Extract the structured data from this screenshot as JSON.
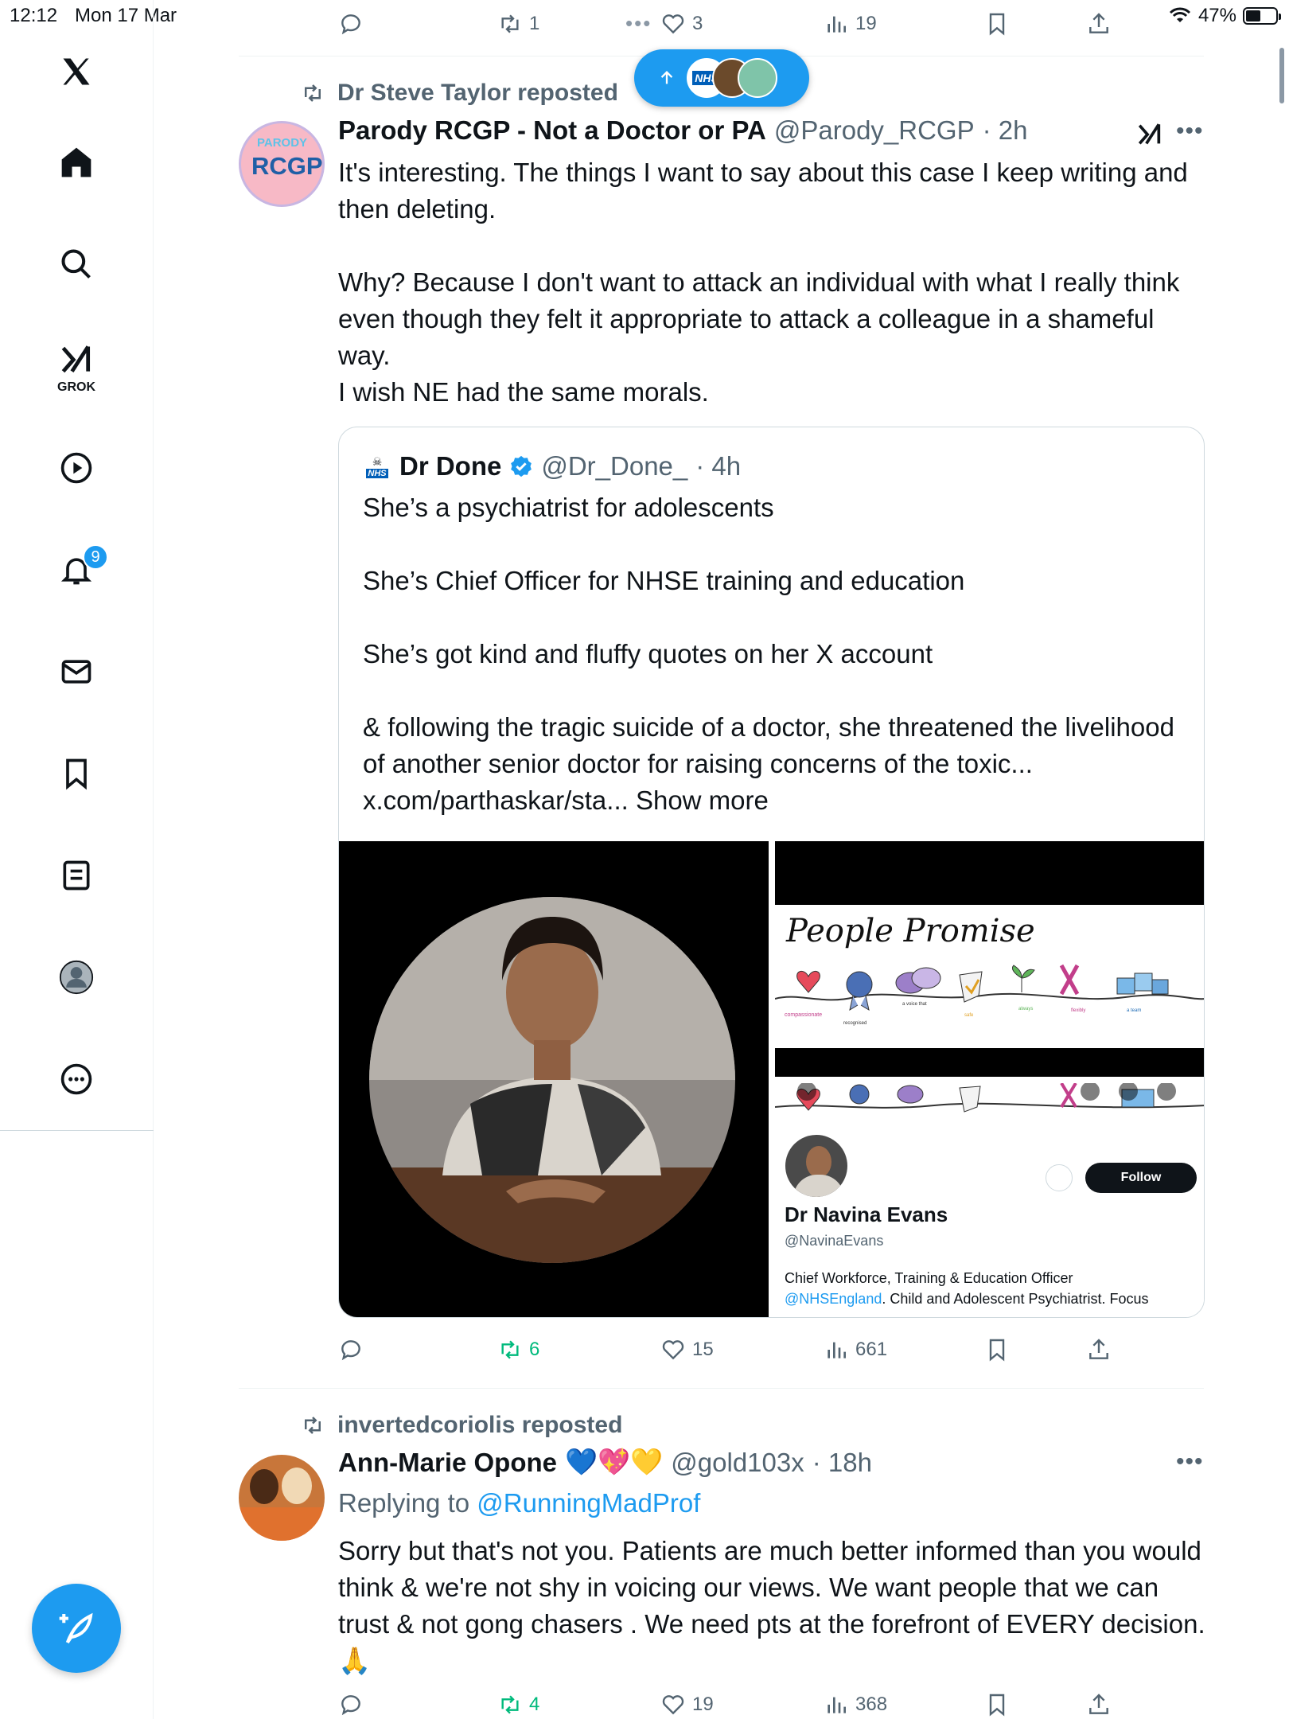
{
  "status": {
    "time": "12:12",
    "date": "Mon 17 Mar",
    "battery": "47%",
    "battery_level": 0.47
  },
  "sidebar": {
    "items": [
      {
        "name": "x-logo-icon"
      },
      {
        "name": "home-icon"
      },
      {
        "name": "search-icon"
      },
      {
        "name": "grok-icon",
        "label": "GROK"
      },
      {
        "name": "video-icon"
      },
      {
        "name": "notifications-icon",
        "badge": "9"
      },
      {
        "name": "messages-icon"
      },
      {
        "name": "bookmarks-icon"
      },
      {
        "name": "lists-icon"
      },
      {
        "name": "profile-icon"
      },
      {
        "name": "more-icon"
      }
    ]
  },
  "top_actions": {
    "reposts": "1",
    "likes": "3",
    "views": "19"
  },
  "tweet1": {
    "reposted_by": "Dr Steve Taylor reposted",
    "author_name": "Parody RCGP - Not a Doctor or PA",
    "handle": "@Parody_RCGP",
    "time": "· 2h",
    "avatar_top": "PARODY",
    "avatar_main": "RCGP",
    "body": "It's interesting. The things I want to say about this case I keep writing and then deleting.\n\nWhy? Because I don't want to attack an individual with what I really think even though they felt it appropriate to attack a colleague in a shameful way.\nI wish NE had the same morals.",
    "quote": {
      "author_name": "Dr Done",
      "handle": "@Dr_Done_",
      "time": "· 4h",
      "avatar_label": "NHS",
      "p1": "She’s a psychiatrist for adolescents",
      "p2": "She’s Chief Officer for NHSE training and education",
      "p3": "She’s got kind and fluffy quotes on her X account",
      "p4": "& following the tragic suicide of a doctor, she threatened the livelihood of another senior doctor for raising concerns of the toxic... x.com/parthaskar/sta... Show more",
      "media_title": "People Promise",
      "profile_name": "Dr Navina Evans",
      "profile_handle": "@NavinaEvans",
      "profile_bio_1": "Chief Workforce, Training & Education Officer",
      "profile_bio_link": "@NHSEngland",
      "profile_bio_2": ". Child and Adolescent Psychiatrist. Focus",
      "follow_label": "Follow"
    },
    "actions": {
      "reposts": "6",
      "likes": "15",
      "views": "661"
    }
  },
  "tweet2": {
    "reposted_by": "invertedcoriolis reposted",
    "author_name": "Ann-Marie Opone",
    "emojis": "💙💖💛",
    "handle": "@gold103x",
    "time": "· 18h",
    "replying_prefix": "Replying to ",
    "replying_to": "@RunningMadProf",
    "body": "Sorry but that's not you. Patients are much better informed than you would think & we're not shy in voicing our views.  We want people that we can trust & not gong chasers . We need pts at the forefront of EVERY decision.  🙏",
    "actions": {
      "reposts": "4",
      "likes": "19",
      "views": "368"
    }
  },
  "colors": {
    "accent": "#1d9bf0",
    "text": "#0f1419",
    "muted": "#536471",
    "repost_green": "#00ba7c"
  }
}
